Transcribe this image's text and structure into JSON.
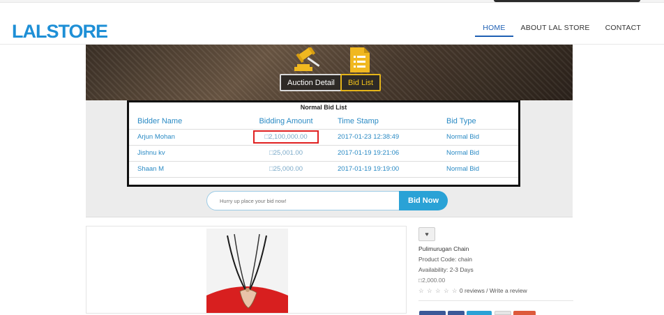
{
  "brand": {
    "logo_text": "LALSTORE",
    "accent": "#1e8fd6"
  },
  "nav": {
    "items": [
      "HOME",
      "ABOUT LAL STORE",
      "CONTACT"
    ],
    "active": "HOME"
  },
  "tabs": {
    "auction_detail": "Auction Detail",
    "bid_list": "Bid List"
  },
  "bid_list": {
    "caption": "Normal Bid List",
    "headers": [
      "Bidder Name",
      "Bidding Amount",
      "Time Stamp",
      "Bid Type"
    ],
    "rows": [
      {
        "name": "Arjun Mohan",
        "amount": "□2,100,000.00",
        "time": "2017-01-23 12:38:49",
        "type": "Normal Bid"
      },
      {
        "name": "Jishnu kv",
        "amount": "□25,001.00",
        "time": "2017-01-19 19:21:06",
        "type": "Normal Bid"
      },
      {
        "name": "Shaan M",
        "amount": "□25,000.00",
        "time": "2017-01-19 19:19:00",
        "type": "Normal Bid"
      }
    ]
  },
  "bid_form": {
    "placeholder": "Hurry up place your bid now!",
    "button": "Bid Now"
  },
  "product": {
    "wishlist_icon": "heart-icon",
    "name": "Pulimurugan Chain",
    "code": "Product Code: chain",
    "availability": "Availability: 2-3 Days",
    "price": "□2,000.00",
    "stars": "☆ ☆ ☆ ☆ ☆",
    "reviews": "0 reviews / Write a review"
  }
}
